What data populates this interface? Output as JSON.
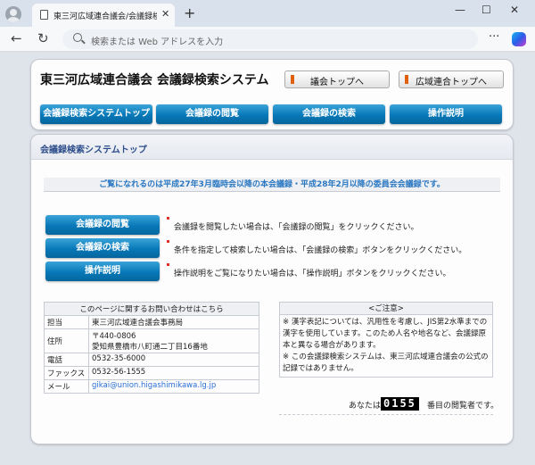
{
  "browser": {
    "tab_title": "東三河広域連合議会/会議録検索",
    "new_tab_symbol": "+",
    "address_placeholder": "検索または Web アドレスを入力",
    "window_controls": [
      "—",
      "☐",
      "✕"
    ]
  },
  "header": {
    "site_title": "東三河広域連合議会 会議録検索システム",
    "top_links": [
      "議会トップへ",
      "広域連合トップへ"
    ],
    "nav": [
      "会議録検索システムトップ",
      "会議録の閲覧",
      "会議録の検索",
      "操作説明"
    ]
  },
  "main": {
    "panel_title": "会議録検索システムトップ",
    "notice": "ご覧になれるのは平成27年3月臨時会以降の本会議録・平成28年2月以降の委員会会議録です。",
    "actions": [
      {
        "label": "会議録の閲覧",
        "text": "会議録を閲覧したい場合は、「会議録の閲覧」をクリックください。"
      },
      {
        "label": "会議録の検索",
        "text": "条件を指定して検索したい場合は、「会議録の検索」ボタンをクリックください。"
      },
      {
        "label": "操作説明",
        "text": "操作説明をご覧になりたい場合は、「操作説明」ボタンをクリックください。"
      }
    ]
  },
  "contact": {
    "heading": "このページに関するお問い合わせはこちら",
    "rows": [
      {
        "key": "担当",
        "value": "東三河広域連合議会事務局"
      },
      {
        "key": "住所",
        "value": "〒440-0806",
        "value2": "愛知県豊橋市八町通二丁目16番地"
      },
      {
        "key": "電話",
        "value": "0532-35-6000"
      },
      {
        "key": "ファックス",
        "value": "0532-56-1555"
      },
      {
        "key": "メール",
        "value": "gikai@union.higashimikawa.lg.jp"
      }
    ]
  },
  "caution": {
    "heading": "<ご注意>",
    "text1": "※ 漢字表記については、汎用性を考慮し、JIS第2水準までの漢字を使用しています。このため人名や地名など、会議録原本と異なる場合があります。",
    "text2": "※ この会議録検索システムは、東三河広域連合議会の公式の記録ではありません。"
  },
  "counter": {
    "prefix": "あなたは",
    "value": "0155",
    "suffix": "番目の閲覧者です。"
  }
}
